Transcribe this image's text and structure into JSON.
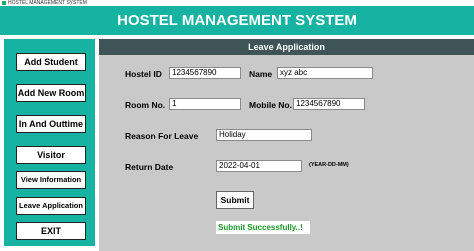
{
  "window": {
    "title": "HOSTEL MANAGEMENT SYSTEM"
  },
  "header": {
    "title": "HOSTEL MANAGEMENT SYSTEM"
  },
  "sidebar": {
    "items": [
      {
        "label": "Add Student"
      },
      {
        "label": "Add New Room"
      },
      {
        "label": "In And Outtime"
      },
      {
        "label": "Visitor"
      },
      {
        "label": "View Information"
      },
      {
        "label": "Leave Application"
      },
      {
        "label": "EXIT"
      }
    ]
  },
  "form": {
    "title": "Leave Application",
    "hostel_id_label": "Hostel ID",
    "hostel_id_value": "1234567890",
    "name_label": "Name",
    "name_value": "xyz abc",
    "room_label": "Room No.",
    "room_value": "1",
    "mobile_label": "Mobile No.",
    "mobile_value": "1234567890",
    "reason_label": "Reason For Leave",
    "reason_value": "Holiday",
    "return_label": "Return Date",
    "return_value": "2022-04-01",
    "date_hint": "(YEAR-DD-MM)",
    "submit_label": "Submit",
    "status_message": "Submit Successfully..!"
  },
  "colors": {
    "header_bg": "#16b3a3",
    "panel_bg": "#c9c9c9",
    "panel_header_bg": "#3e5457",
    "success_text": "#1a9a2a"
  }
}
